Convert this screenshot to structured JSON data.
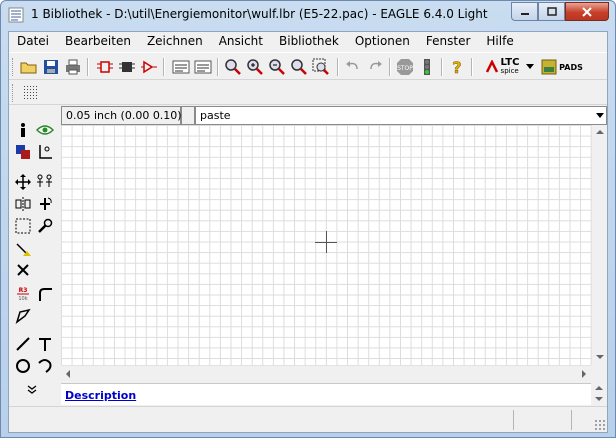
{
  "window": {
    "title": "1 Bibliothek - D:\\util\\Energiemonitor\\wulf.lbr (E5-22.pac) - EAGLE 6.4.0 Light"
  },
  "menu": {
    "items": [
      {
        "label": "Datei"
      },
      {
        "label": "Bearbeiten"
      },
      {
        "label": "Zeichnen"
      },
      {
        "label": "Ansicht"
      },
      {
        "label": "Bibliothek"
      },
      {
        "label": "Optionen"
      },
      {
        "label": "Fenster"
      },
      {
        "label": "Hilfe"
      }
    ]
  },
  "toolbar": {
    "icons": [
      "open-icon",
      "save-icon",
      "print-icon",
      "schematic-icon",
      "board-icon",
      "symbol-icon",
      "script-icon",
      "ulp-icon",
      "zoom-fit-icon",
      "zoom-in-icon",
      "zoom-out-icon",
      "zoom-redraw-icon",
      "zoom-select-icon",
      "undo-icon",
      "redo-icon",
      "stop-icon",
      "go-icon",
      "help-icon"
    ],
    "ltc_label": "LTC",
    "ltc_sub": "spice",
    "pads_label": "PADS"
  },
  "commandbar": {
    "coords": "0.05 inch (0.00 0.10)",
    "command": "paste"
  },
  "description": {
    "link": "Description"
  },
  "colors": {
    "accent": "#0000cc",
    "canvas_grid": "#dcdcdc",
    "close_button": "#c7402a"
  }
}
